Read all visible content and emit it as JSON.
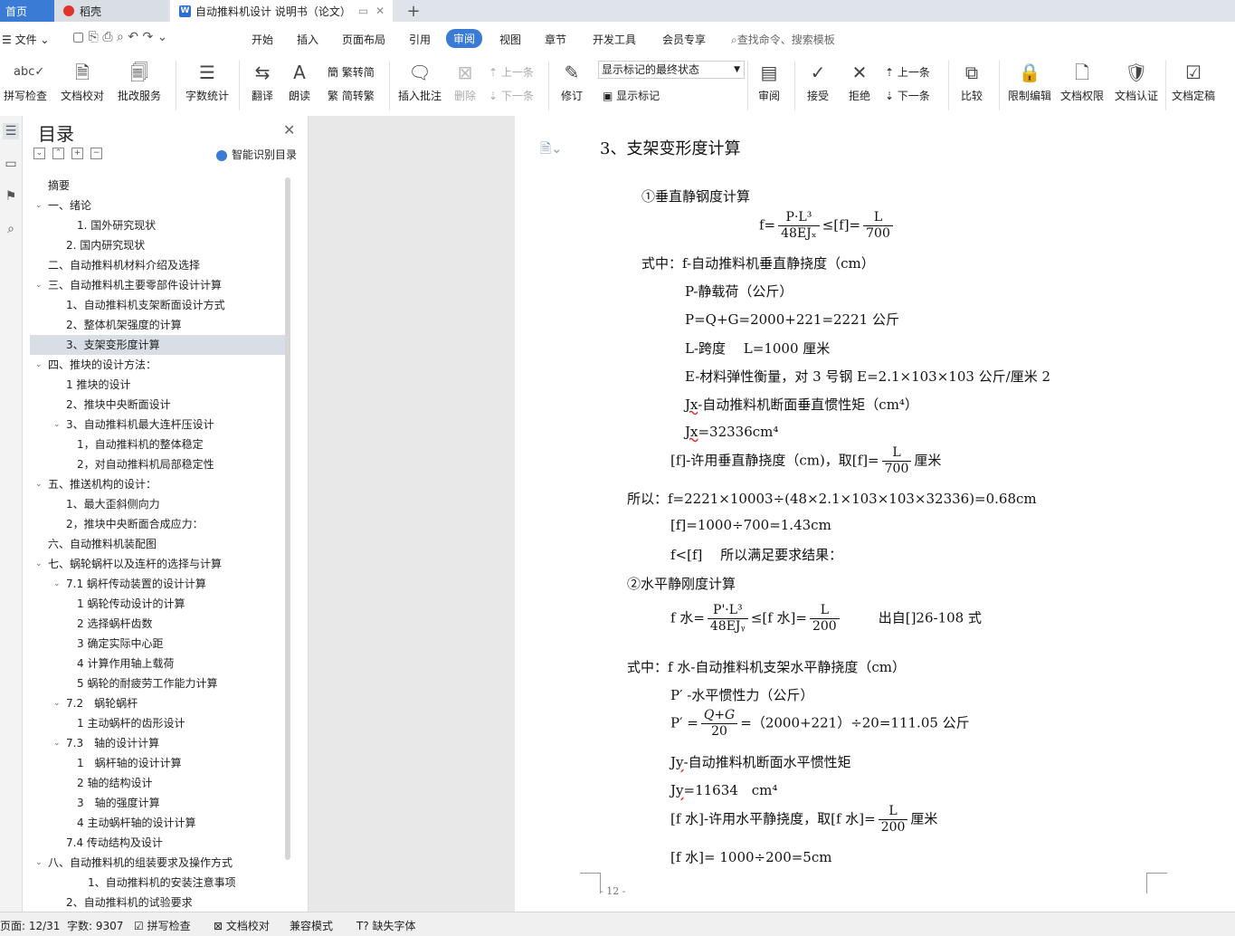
{
  "tabs": {
    "home": "首页",
    "daoke": "稻壳",
    "doc": "自动推料机设计 说明书（论文）"
  },
  "menu": {
    "file": "文件",
    "items": [
      "开始",
      "插入",
      "页面布局",
      "引用",
      "审阅",
      "视图",
      "章节",
      "开发工具",
      "会员专享"
    ],
    "active": "审阅",
    "search_placeholder": "查找命令、搜索模板"
  },
  "ribbon": {
    "spell": "拼写检查",
    "proof": "文档校对",
    "batch": "批改服务",
    "count": "字数统计",
    "translate": "翻译",
    "read": "朗读",
    "trad": "繁转简",
    "simp": "简转繁",
    "insert_comment": "插入批注",
    "delete": "删除",
    "prev": "上一条",
    "next": "下一条",
    "track": "修订",
    "markup_state": "显示标记的最终状态",
    "show_markup": "显示标记",
    "review": "审阅",
    "accept": "接受",
    "reject": "拒绝",
    "prev2": "上一条",
    "next2": "下一条",
    "compare": "比较",
    "restrict": "限制编辑",
    "permission": "文档权限",
    "certify": "文档认证",
    "finalize": "文档定稿"
  },
  "toc": {
    "title": "目录",
    "smart": "智能识别目录",
    "items": [
      {
        "text": "摘要",
        "indent": 0,
        "caret": ""
      },
      {
        "text": "一、绪论",
        "indent": 0,
        "caret": "v"
      },
      {
        "text": "1. 国外研究现状",
        "indent": 2,
        "caret": ""
      },
      {
        "text": "2. 国内研究现状",
        "indent": 1,
        "caret": ""
      },
      {
        "text": "二、自动推料机材料介绍及选择",
        "indent": 0,
        "caret": ""
      },
      {
        "text": "三、自动推料机主要零部件设计计算",
        "indent": 0,
        "caret": "v"
      },
      {
        "text": "1、自动推料机支架断面设计方式",
        "indent": 1,
        "caret": ""
      },
      {
        "text": "2、整体机架强度的计算",
        "indent": 1,
        "caret": ""
      },
      {
        "text": "3、支架变形度计算",
        "indent": 1,
        "caret": "",
        "selected": true
      },
      {
        "text": "四、推块的设计方法：",
        "indent": 0,
        "caret": "v"
      },
      {
        "text": "1 推块的设计",
        "indent": 1,
        "caret": ""
      },
      {
        "text": "2、推块中央断面设计",
        "indent": 1,
        "caret": ""
      },
      {
        "text": "3、自动推料机最大连杆压设计",
        "indent": 1,
        "caret": "v"
      },
      {
        "text": "1，自动推料机的整体稳定",
        "indent": 2,
        "caret": ""
      },
      {
        "text": "2，对自动推料机局部稳定性",
        "indent": 2,
        "caret": ""
      },
      {
        "text": "五、推送机构的设计：",
        "indent": 0,
        "caret": "v"
      },
      {
        "text": "1、最大歪斜侧向力",
        "indent": 1,
        "caret": ""
      },
      {
        "text": "2，推块中央断面合成应力：",
        "indent": 1,
        "caret": ""
      },
      {
        "text": "六、自动推料机装配图",
        "indent": 0,
        "caret": ""
      },
      {
        "text": "七、蜗轮蜗杆以及连杆的选择与计算",
        "indent": 0,
        "caret": "v"
      },
      {
        "text": "7.1 蜗杆传动装置的设计计算",
        "indent": 1,
        "caret": "v"
      },
      {
        "text": "1 蜗轮传动设计的计算",
        "indent": 2,
        "caret": ""
      },
      {
        "text": "2 选择蜗杆齿数",
        "indent": 2,
        "caret": ""
      },
      {
        "text": "3 确定实际中心距",
        "indent": 2,
        "caret": ""
      },
      {
        "text": "4 计算作用轴上载荷",
        "indent": 2,
        "caret": ""
      },
      {
        "text": "5 蜗轮的耐疲劳工作能力计算",
        "indent": 2,
        "caret": ""
      },
      {
        "text": "7.2　蜗轮蜗杆",
        "indent": 1,
        "caret": "v"
      },
      {
        "text": "1 主动蜗杆的齿形设计",
        "indent": 2,
        "caret": ""
      },
      {
        "text": "7.3　轴的设计计算",
        "indent": 1,
        "caret": "v"
      },
      {
        "text": "1　蜗杆轴的设计计算",
        "indent": 2,
        "caret": ""
      },
      {
        "text": "2 轴的结构设计",
        "indent": 2,
        "caret": ""
      },
      {
        "text": "3　轴的强度计算",
        "indent": 2,
        "caret": ""
      },
      {
        "text": "4 主动蜗杆轴的设计计算",
        "indent": 2,
        "caret": ""
      },
      {
        "text": "7.4 传动结构及设计",
        "indent": 1,
        "caret": ""
      },
      {
        "text": "八、自动推料机的组装要求及操作方式",
        "indent": 0,
        "caret": "v"
      },
      {
        "text": "1、自动推料机的安装注意事项",
        "indent": 3,
        "caret": ""
      },
      {
        "text": "2、自动推料机的试验要求",
        "indent": 1,
        "caret": ""
      }
    ]
  },
  "doc": {
    "heading": "3、支架变形度计算",
    "l1": "①垂直静钢度计算",
    "f1_lhs": "f=",
    "f1_num": "P·L³",
    "f1_den": "48EJₓ",
    "f1_mid": "≤[f]=",
    "f1_num2": "L",
    "f1_den2": "700",
    "l2": "式中：f-自动推料机垂直静挠度（cm）",
    "l3": "P-静载荷（公斤）",
    "l4": "P=Q+G=2000+221=2221 公斤",
    "l5": "L-跨度　 L=1000 厘米",
    "l6": "E-材料弹性衡量，对 3 号钢 E=2.1×103×103 公斤/厘米 2",
    "l7a": "Jx",
    "l7b": "-自动推料机断面垂直惯性矩（cm⁴）",
    "l8a": "Jx",
    "l8b": "=32336cm⁴",
    "l9a": "[f]-许用垂直静挠度（cm)，取[f]=",
    "l9num": "L",
    "l9den": "700",
    "l9b": "厘米",
    "l10": "所以：f=2221×10003÷(48×2.1×103×103×32336)=0.68cm",
    "l11": "[f]=1000÷700=1.43cm",
    "l12": "f<[f]　 所以满足要求结果：",
    "l13": "②水平静刚度计算",
    "f2_lhs": "f 水=",
    "f2_num": "P'·L³",
    "f2_den": "48EJᵧ",
    "f2_mid": "≤[f 水]=",
    "f2_num2": "L",
    "f2_den2": "200",
    "f2_src": "出自[]26-108 式",
    "l14": "式中：f 水-自动推料机支架水平静挠度（cm）",
    "l15": "P′ -水平惯性力（公斤）",
    "l16a": "P′ =",
    "l16num": "Q+G",
    "l16den": "20",
    "l16b": "=（2000+221）÷20=111.05 公斤",
    "l17a": "Jy",
    "l17b": "-自动推料机断面水平惯性矩",
    "l18a": "Jy",
    "l18b": "=11634　cm⁴",
    "l19a": "[f 水]-许用水平静挠度，取[f 水]=",
    "l19num": "L",
    "l19den": "200",
    "l19b": "厘米",
    "l20": "[f 水]= 1000÷200=5cm",
    "page_num": "- 12 -"
  },
  "status": {
    "page": "页面: 12/31",
    "words": "字数: 9307",
    "spell": "拼写检查",
    "proof": "文档校对",
    "compat": "兼容模式",
    "missing_font": "缺失字体"
  }
}
